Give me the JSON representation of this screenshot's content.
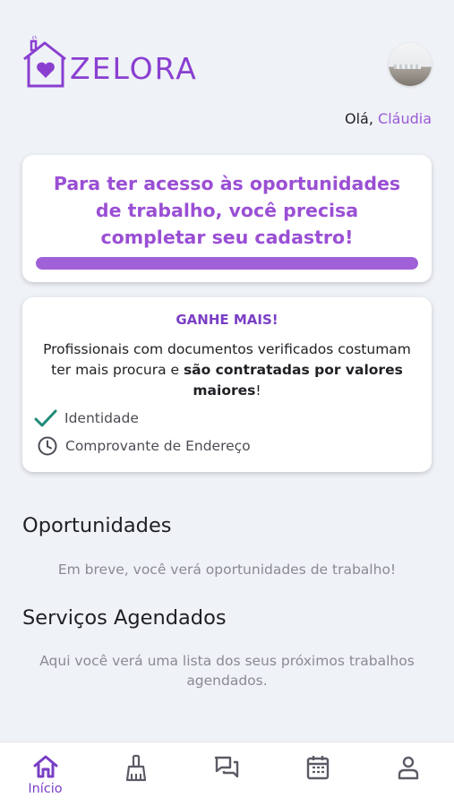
{
  "header": {
    "logo_text": "ZELORA",
    "greeting_prefix": "Olá, ",
    "user_name": "Cláudia"
  },
  "cadastro_card": {
    "message": "Para ter acesso às oportunidades de trabalho, você precisa completar seu cadastro!",
    "progress_fraction": 1.0
  },
  "ganhe_card": {
    "title": "GANHE MAIS!",
    "body_part1": "Profissionais com documentos verificados costumam ter mais procura e ",
    "body_bold": "são contratadas por valores maiores",
    "body_part2": "!",
    "items": [
      {
        "label": "Identidade",
        "icon": "check-icon",
        "color": "#1f8a7a"
      },
      {
        "label": "Comprovante de Endereço",
        "icon": "clock-icon",
        "color": "#4b4b55"
      }
    ]
  },
  "sections": {
    "oportunidades_title": "Oportunidades",
    "oportunidades_text": "Em breve, você verá oportunidades de trabalho!",
    "servicos_title": "Serviços Agendados",
    "servicos_text": "Aqui você verá uma lista dos seus próximos trabalhos agendados."
  },
  "bottom_nav": {
    "items": [
      {
        "icon": "home-icon",
        "label": "Início",
        "active": true
      },
      {
        "icon": "broom-icon",
        "label": "",
        "active": false
      },
      {
        "icon": "chat-icon",
        "label": "",
        "active": false
      },
      {
        "icon": "calendar-icon",
        "label": "",
        "active": false
      },
      {
        "icon": "user-icon",
        "label": "",
        "active": false
      }
    ]
  },
  "colors": {
    "brand": "#8a3fd1",
    "accent": "#9a4fd4",
    "background": "#eff2f7",
    "check": "#1f8a7a"
  }
}
